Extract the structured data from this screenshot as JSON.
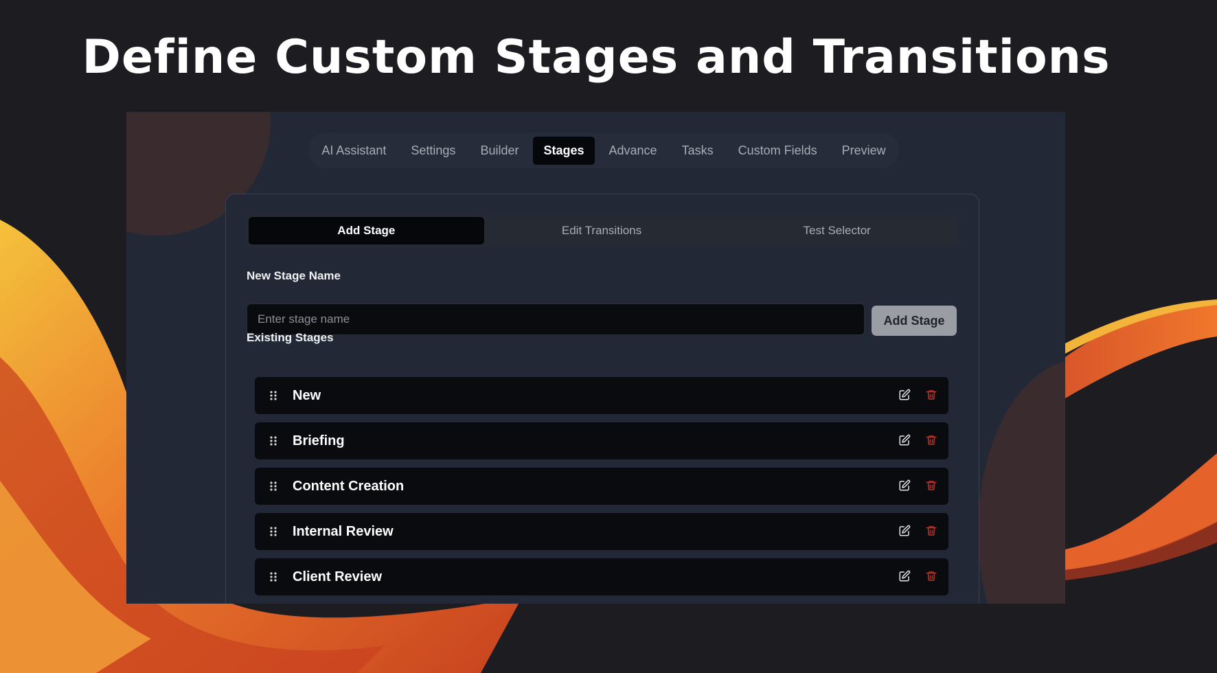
{
  "headline": "Define Custom Stages and Transitions",
  "nav": {
    "tabs": [
      {
        "label": "AI Assistant"
      },
      {
        "label": "Settings"
      },
      {
        "label": "Builder"
      },
      {
        "label": "Stages"
      },
      {
        "label": "Advance"
      },
      {
        "label": "Tasks"
      },
      {
        "label": "Custom Fields"
      },
      {
        "label": "Preview"
      }
    ],
    "active": "Stages"
  },
  "subtabs": {
    "tabs": [
      {
        "label": "Add Stage"
      },
      {
        "label": "Edit Transitions"
      },
      {
        "label": "Test Selector"
      }
    ],
    "active": "Add Stage"
  },
  "form": {
    "new_stage_label": "New Stage Name",
    "input_placeholder": "Enter stage name",
    "input_value": "",
    "add_button_label": "Add Stage"
  },
  "existing": {
    "label": "Existing Stages",
    "stages": [
      {
        "name": "New"
      },
      {
        "name": "Briefing"
      },
      {
        "name": "Content Creation"
      },
      {
        "name": "Internal Review"
      },
      {
        "name": "Client Review"
      }
    ]
  },
  "icons": {
    "grip": "drag-handle-icon",
    "edit": "edit-icon",
    "delete": "trash-icon"
  },
  "colors": {
    "accent_active": "#05070b",
    "delete_red": "#b3362e",
    "panel_bg": "#222836",
    "wave_orange": "#e8642a",
    "wave_yellow": "#f2b43a"
  }
}
